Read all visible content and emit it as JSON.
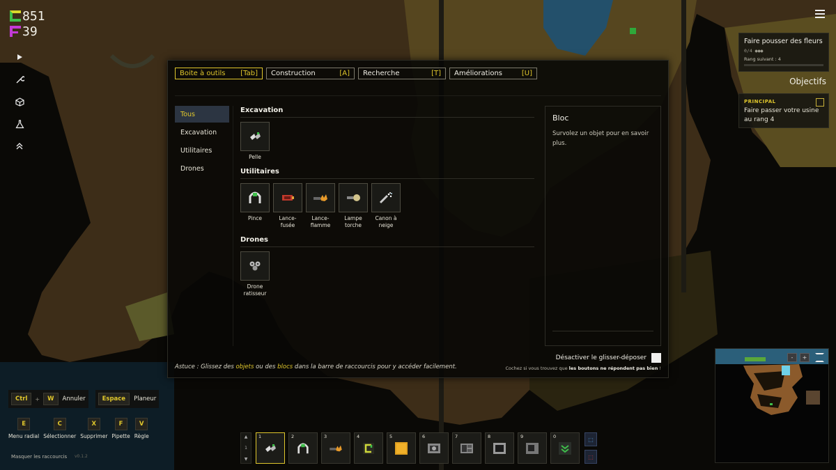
{
  "currency": {
    "credits": "851",
    "fuel": "39"
  },
  "left_tools": [
    "play-icon",
    "wrench-icon",
    "cube-icon",
    "flask-icon",
    "chevrons-up-icon"
  ],
  "objective": {
    "title": "Faire pousser des fleurs",
    "progress": "0/4 ●●●",
    "next_rank": "Rang suivant : 4",
    "heading": "Objectifs",
    "main_label": "PRINCIPAL",
    "main_text": "Faire passer votre usine au rang 4"
  },
  "tabs": [
    {
      "label": "Boite à outils",
      "key": "[Tab]",
      "active": true
    },
    {
      "label": "Construction",
      "key": "[A]",
      "active": false
    },
    {
      "label": "Recherche",
      "key": "[T]",
      "active": false
    },
    {
      "label": "Améliorations",
      "key": "[U]",
      "active": false
    }
  ],
  "categories": [
    {
      "label": "Tous",
      "active": true
    },
    {
      "label": "Excavation",
      "active": false
    },
    {
      "label": "Utilitaires",
      "active": false
    },
    {
      "label": "Drones",
      "active": false
    }
  ],
  "sections": {
    "excavation": {
      "title": "Excavation",
      "items": [
        "Pelle"
      ]
    },
    "utilitaires": {
      "title": "Utilitaires",
      "items": [
        "Pince",
        "Lance-fusée",
        "Lance-flamme",
        "Lampe torche",
        "Canon à neige"
      ]
    },
    "drones": {
      "title": "Drones",
      "items": [
        "Drone ratisseur"
      ]
    }
  },
  "info": {
    "title": "Bloc",
    "description": "Survolez un objet pour en savoir plus."
  },
  "drag_toggle": {
    "label": "Désactiver le glisser-déposer",
    "checked": false
  },
  "tip": {
    "prefix": "Astuce : Glissez des ",
    "w1": "objets",
    "mid": " ou des ",
    "w2": "blocs",
    "suffix": " dans la barre de raccourcis pour y accéder facilement."
  },
  "hint": {
    "prefix": "Cochez si vous trouvez que ",
    "bold": "les boutons ne répondent pas bien",
    "suffix": " !"
  },
  "shortcuts": {
    "ctrl": "Ctrl",
    "plus": "+",
    "w": "W",
    "undo": "Annuler",
    "space": "Espace",
    "glide": "Planeur",
    "keys": [
      {
        "key": "E",
        "label": "Menu radial"
      },
      {
        "key": "C",
        "label": "Sélectionner"
      },
      {
        "key": "X",
        "label": "Supprimer"
      },
      {
        "key": "F",
        "label": "Pipette"
      },
      {
        "key": "V",
        "label": "Règle"
      }
    ],
    "hide": "Masquer les raccourcis",
    "version": "v0.1.2"
  },
  "hotbar": {
    "arrows": [
      "▲",
      "1",
      "▼"
    ],
    "slots": [
      "1",
      "2",
      "3",
      "4",
      "5",
      "6",
      "7",
      "8",
      "9",
      "0"
    ],
    "active": "1"
  },
  "minimap": {
    "buttons": [
      "-",
      "+"
    ]
  },
  "colors": {
    "accent": "#e0c72c",
    "panel": "#080806",
    "active_category": "#2c3542"
  }
}
